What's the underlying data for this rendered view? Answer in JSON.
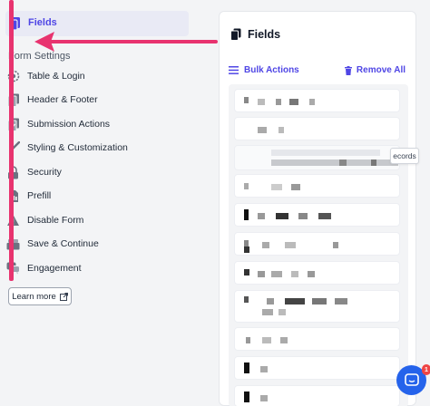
{
  "sidebar": {
    "active_item": {
      "label": "Fields",
      "icon": "fields-icon"
    },
    "section_title": "Form Settings",
    "items": [
      {
        "label": "Table & Login",
        "icon": "gear-icon"
      },
      {
        "label": "Header & Footer",
        "icon": "document-icon"
      },
      {
        "label": "Submission Actions",
        "icon": "checklist-icon"
      },
      {
        "label": "Styling & Customization",
        "icon": "paintbrush-icon"
      },
      {
        "label": "Security",
        "icon": "lock-icon"
      },
      {
        "label": "Prefill",
        "icon": "chart-icon"
      },
      {
        "label": "Disable Form",
        "icon": "warning-icon"
      },
      {
        "label": "Save & Continue",
        "icon": "drawer-icon"
      },
      {
        "label": "Engagement",
        "icon": "chat-bubbles-icon"
      }
    ],
    "learn_more": "Learn more"
  },
  "panel": {
    "title": "Fields",
    "bulk_actions": "Bulk Actions",
    "remove_all": "Remove All",
    "tooltip_text": "ecords"
  },
  "chat": {
    "badge": "1"
  },
  "colors": {
    "accent": "#4f46e5",
    "annotation": "#e8336f",
    "chat": "#2563eb"
  }
}
